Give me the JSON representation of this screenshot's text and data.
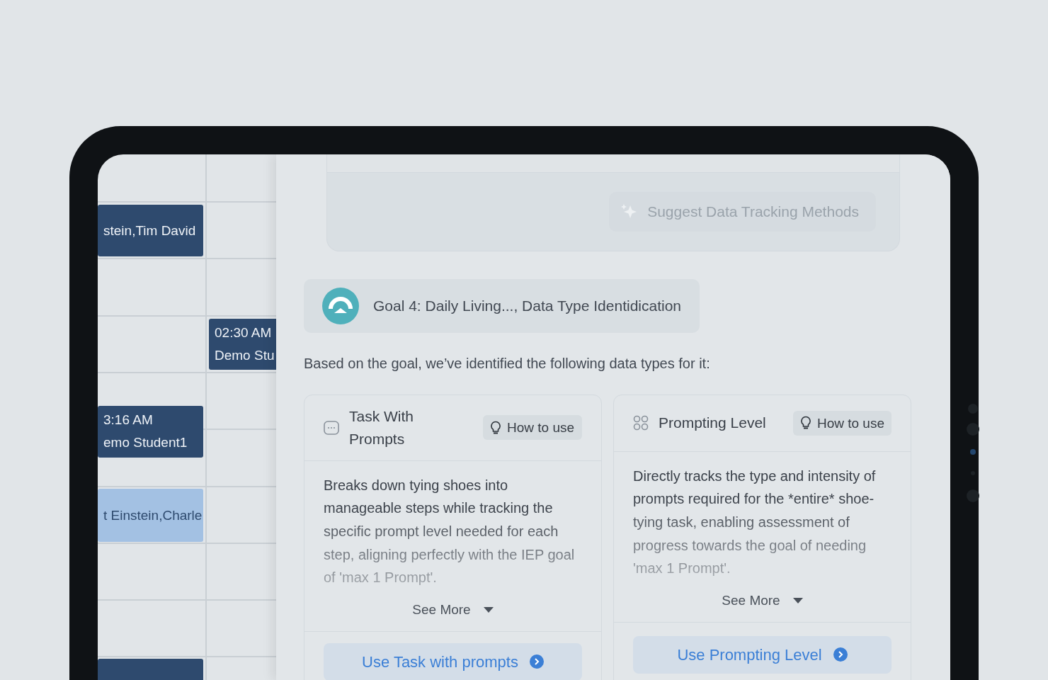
{
  "calendar": {
    "events": [
      {
        "lines": [
          "stein,Tim David"
        ],
        "color": "#2e4a6e"
      },
      {
        "lines": [
          "02:30 AM",
          "Demo Stu"
        ],
        "color": "#2e4a6e"
      },
      {
        "lines": [
          "3:16 AM",
          "emo Student1"
        ],
        "color": "#2e4a6e"
      },
      {
        "lines": [
          "t Einstein,Charle"
        ],
        "color": "#a3c1e3"
      },
      {
        "color": "#2e4a6e"
      }
    ]
  },
  "panel": {
    "suggest_button": {
      "label": "Suggest Data Tracking Methods",
      "disabled": true
    },
    "goal": {
      "label": "Goal 4: Daily Living..., Data Type Identidication"
    },
    "intro": "Based on the goal, we’ve identified the following data types for it:",
    "data_types": [
      {
        "kind": "task",
        "title": "Task With Prompts",
        "help_label": "How to use",
        "description": "Breaks down tying shoes into manageable steps while tracking the specific prompt level needed for each step, aligning perfectly with the IEP goal of 'max 1 Prompt'.",
        "see_more": "See More",
        "action": "Use Task with prompts"
      },
      {
        "kind": "level",
        "title": "Prompting Level",
        "help_label": "How to use",
        "description": "Directly tracks the type and intensity of prompts required for the *entire* shoe-tying task, enabling assessment of progress towards the goal of needing 'max 1 Prompt'.",
        "see_more": "See More",
        "action": "Use Prompting Level"
      }
    ]
  }
}
